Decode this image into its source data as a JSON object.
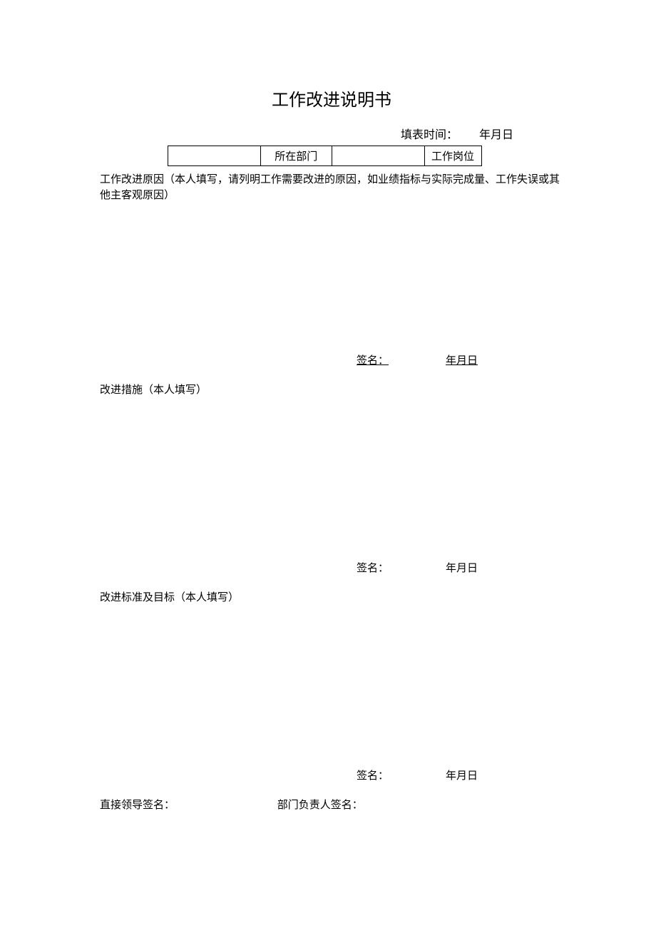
{
  "title": "工作改进说明书",
  "fillTime": {
    "label": "填表时间：",
    "date": "年月日"
  },
  "infoRow": {
    "deptLabel": "所在部门",
    "posLabel": "工作岗位"
  },
  "section1": {
    "prompt": "工作改进原因（本人填写，请列明工作需要改进的原因，如业绩指标与实际完成量、工作失误或其他主客观原因）",
    "sigLabel": "签名：",
    "sigDate": "年月日"
  },
  "section2": {
    "heading": "改进措施（本人填写）",
    "sigLabel": "签名：",
    "sigDate": "年月日"
  },
  "section3": {
    "heading": "改进标准及目标（本人填写）",
    "sigLabel": "签名：",
    "sigDate": "年月日"
  },
  "finalSig": {
    "leader": "直接领导签名：",
    "dept": "部门负责人签名："
  }
}
